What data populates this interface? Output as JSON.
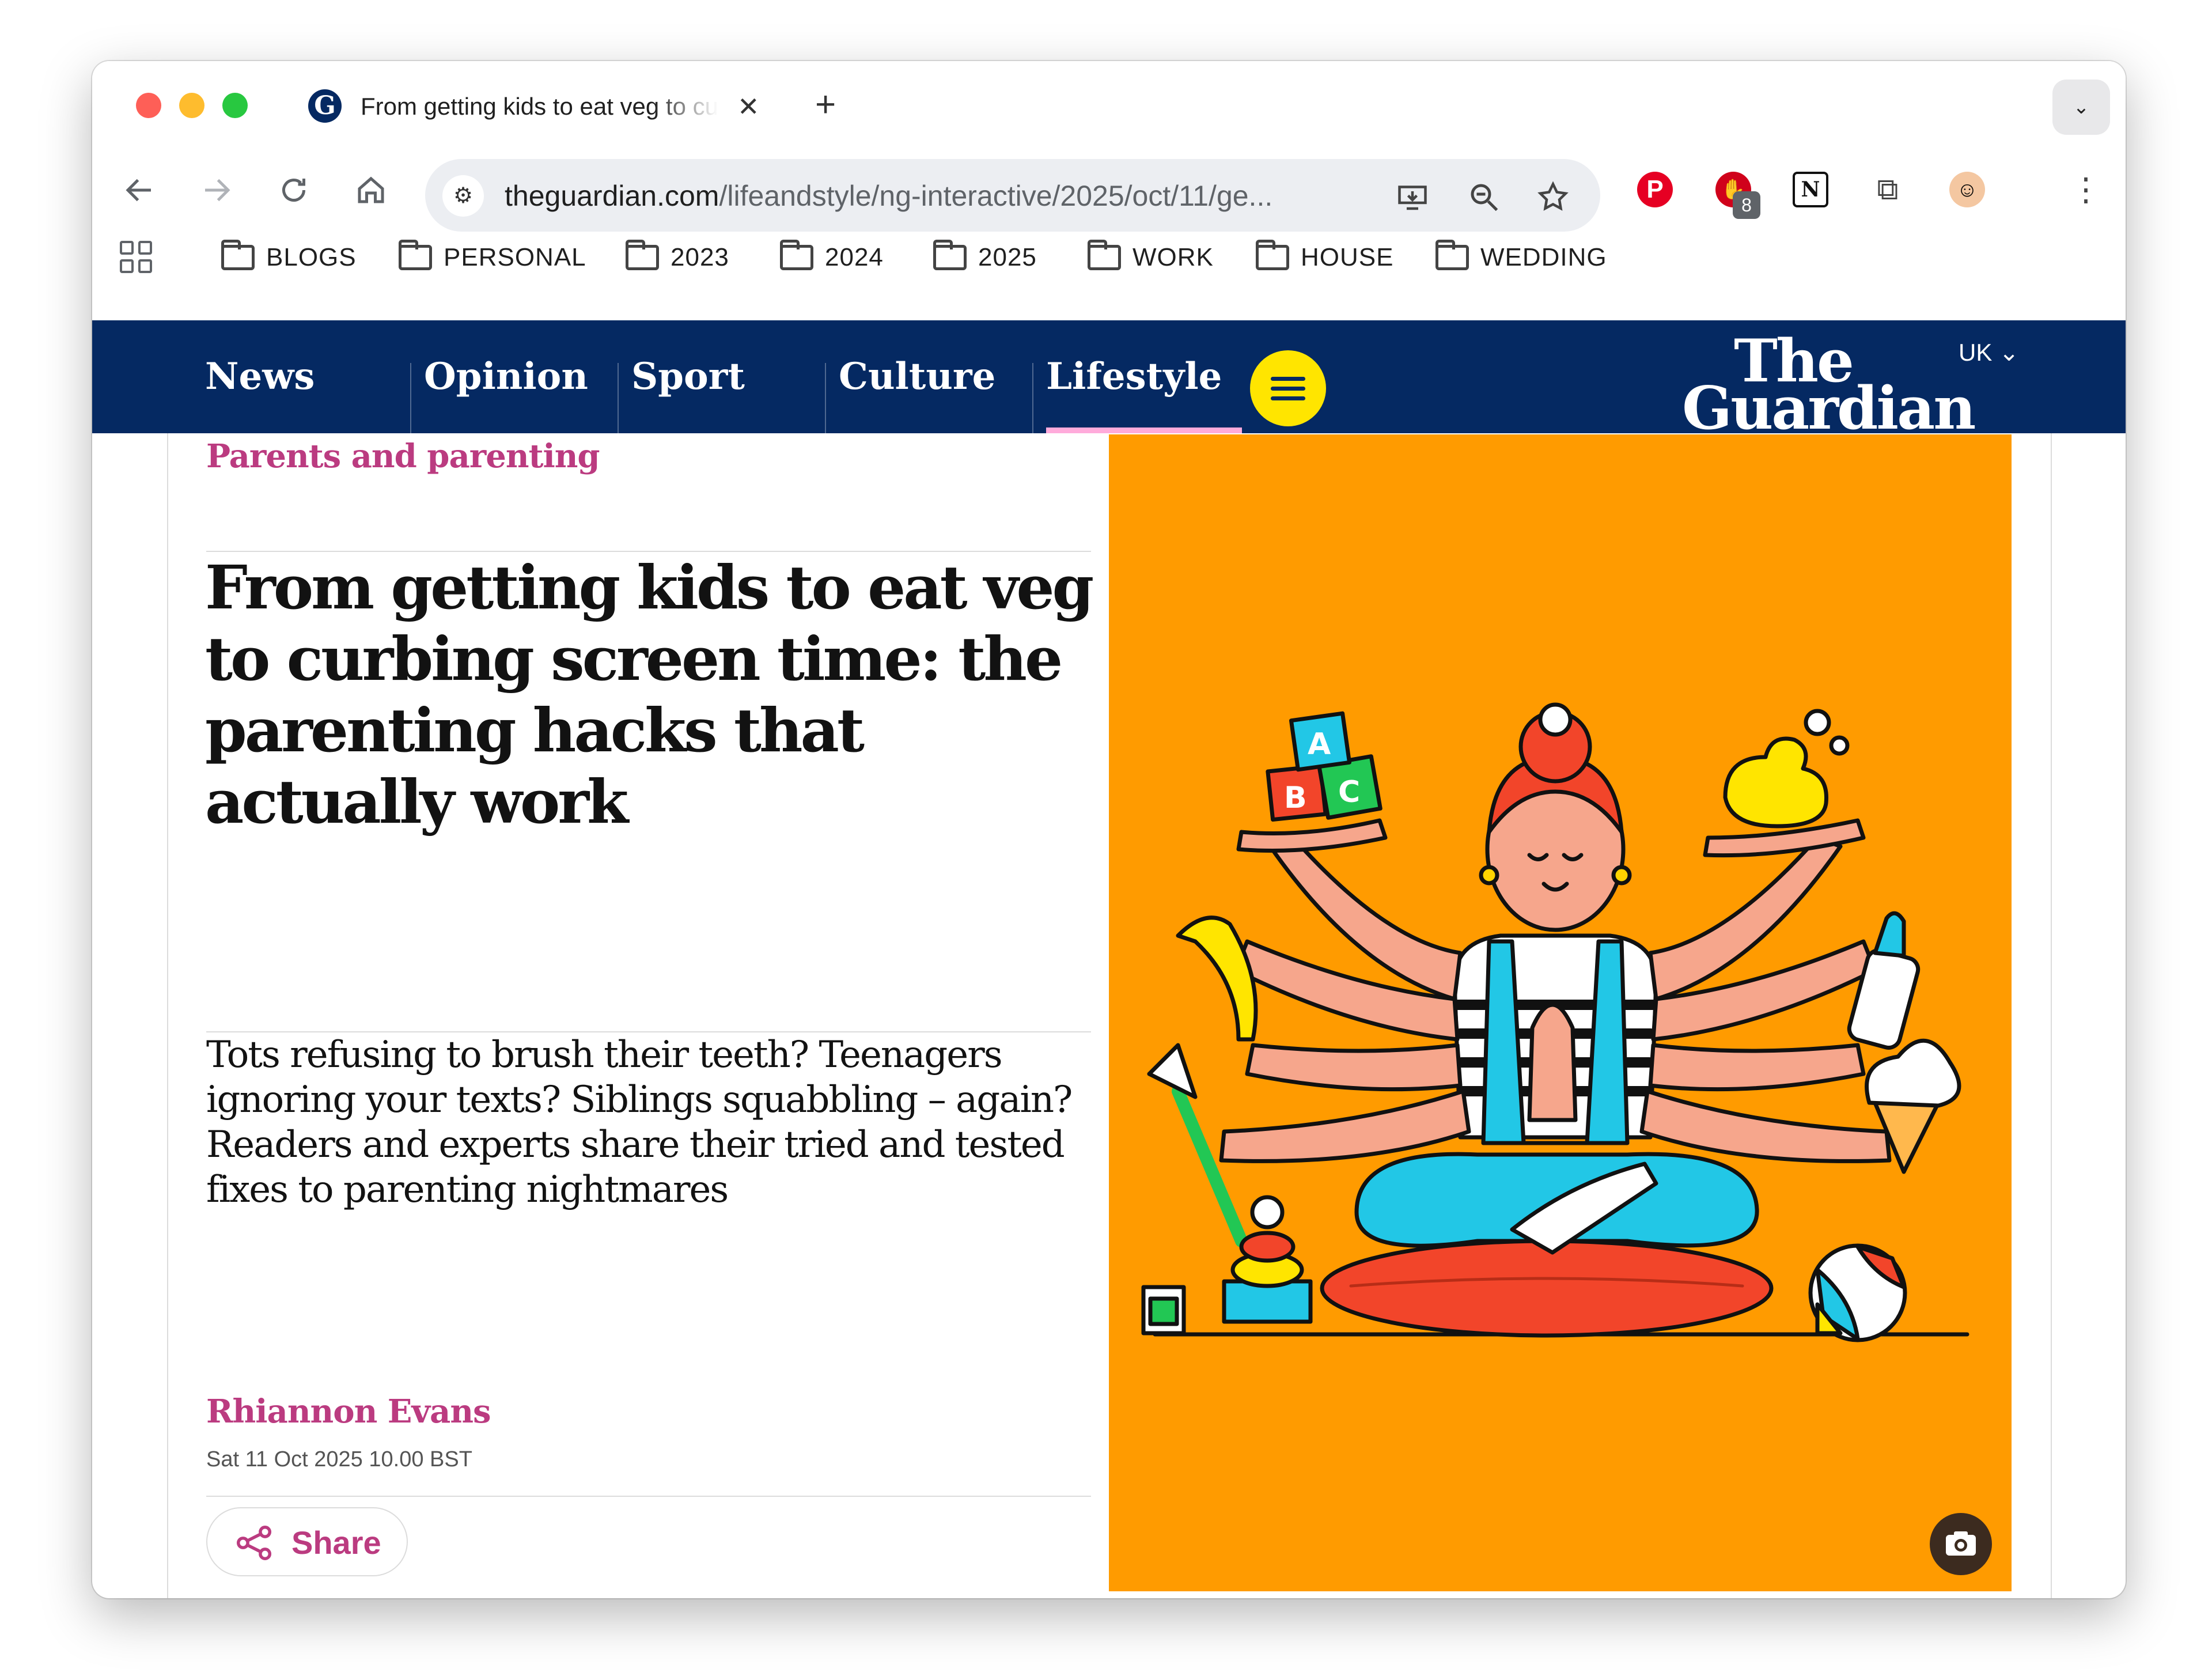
{
  "browser": {
    "tab_title": "From getting kids to eat veg to curbing screen time",
    "tab_close_glyph": "✕",
    "new_tab_glyph": "+",
    "tab_menu_glyph": "⌄",
    "url_host": "theguardian.com",
    "url_path": "/lifeandstyle/ng-interactive/2025/oct/11/ge...",
    "extension_badge": "8",
    "bookmarks": [
      "BLOGS",
      "PERSONAL",
      "2023",
      "2024",
      "2025",
      "WORK",
      "HOUSE",
      "WEDDING"
    ],
    "icons": {
      "back": "arrow-left-icon",
      "forward": "arrow-right-icon",
      "reload": "reload-icon",
      "home": "home-icon",
      "site_settings": "tune-icon",
      "install": "install-icon",
      "zoom": "zoom-icon",
      "bookmark": "star-icon"
    }
  },
  "guardian_nav": {
    "items": [
      "News",
      "Opinion",
      "Sport",
      "Culture",
      "Lifestyle"
    ],
    "active": "Lifestyle",
    "logo_line1": "The",
    "logo_line2": "Guardian",
    "edition": "UK",
    "colors": {
      "nav_bg": "#052962",
      "menu_button": "#ffe500",
      "active_underline": "#ffabdb"
    }
  },
  "article": {
    "kicker": "Parents and parenting",
    "headline": "From getting kids to eat veg to curbing screen time: the parenting hacks that actually work",
    "standfirst": "Tots refusing to brush their teeth? Teenagers ignoring your texts? Siblings squabbling – again? Readers and experts share their tried and tested fixes to parenting nightmares",
    "byline": "Rhiannon Evans",
    "date": "Sat 11 Oct 2025 10.00 BST",
    "share_label": "Share",
    "accent_color": "#bb3b80"
  },
  "illustration": {
    "block_letters": [
      "A",
      "B",
      "C"
    ],
    "background": "#ff9b00",
    "caption_button_icon": "camera-icon"
  }
}
